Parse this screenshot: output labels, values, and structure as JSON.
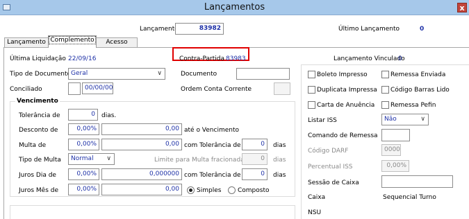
{
  "window": {
    "title": "Lançamentos",
    "close_glyph": "x"
  },
  "header": {
    "lancamento_label": "Lançamento",
    "lancamento_value": "83982",
    "ultimo_label": "Último Lançamento",
    "ultimo_value": "0"
  },
  "tabs": [
    {
      "label": "Lançamento",
      "active": false
    },
    {
      "label": "Complemento",
      "active": true
    },
    {
      "label": "Acesso",
      "active": false
    }
  ],
  "form": {
    "ultima_liquidacao_label": "Última Liquidação",
    "ultima_liquidacao_value": "22/09/16",
    "contra_partida_label": "Contra-Partida",
    "contra_partida_value": "83983",
    "lancamento_vinculado_label": "Lançamento Vinculado",
    "lancamento_vinculado_value": "0",
    "tipo_documento_label": "Tipo de Documento",
    "tipo_documento_value": "Geral",
    "documento_label": "Documento",
    "documento_value": "",
    "conciliado_label": "Conciliado",
    "conciliado_date": "00/00/00",
    "ordem_label": "Ordem Conta Corrente",
    "ordem_value": ""
  },
  "vencimento": {
    "title": "Vencimento",
    "tolerancia_label": "Tolerância de",
    "tolerancia_value": "0",
    "tolerancia_unit": "dias.",
    "desconto_label": "Desconto de",
    "desconto_pct": "0,00%",
    "desconto_value": "0,00",
    "desconto_suffix": "até o Vencimento",
    "multa_label": "Multa de",
    "multa_pct": "0,00%",
    "multa_value": "0,00",
    "multa_tol_label": "com Tolerância de",
    "multa_tol_value": "0",
    "multa_tol_unit": "dias",
    "tipo_multa_label": "Tipo de Multa",
    "tipo_multa_value": "Normal",
    "limite_label": "Limite para Multa fracionada",
    "limite_value": "0",
    "limite_unit": "dias",
    "juros_dia_label": "Juros Dia de",
    "juros_dia_pct": "0,00%",
    "juros_dia_value": "0,000000",
    "juros_dia_tol_label": "com Tolerância de",
    "juros_dia_tol_value": "0",
    "juros_dia_tol_unit": "dias",
    "juros_mes_label": "Juros Mês de",
    "juros_mes_pct": "0,00%",
    "juros_mes_value": "0,00",
    "simples_label": "Simples",
    "composto_label": "Composto",
    "selected": "Simples"
  },
  "right": {
    "boleto_impresso": "Boleto Impresso",
    "remessa_enviada": "Remessa Enviada",
    "duplicata_impressa": "Duplicata Impressa",
    "codigo_barras_lido": "Código Barras Lido",
    "carta_anuencia": "Carta de Anuência",
    "remessa_pefin": "Remessa Pefin",
    "listar_iss_label": "Listar ISS",
    "listar_iss_value": "Não",
    "comando_remessa_label": "Comando de Remessa",
    "comando_remessa_value": "",
    "codigo_darf_label": "Código DARF",
    "codigo_darf_value": "0000",
    "percentual_iss_label": "Percentual ISS",
    "percentual_iss_value": "0,00%",
    "sessao_caixa_label": "Sessão de Caixa",
    "sessao_caixa_value": "",
    "caixa_label": "Caixa",
    "sequencial_turno_label": "Sequencial Turno",
    "nsu_label": "NSU"
  },
  "colors": {
    "titlebar": "#a6c8ea",
    "highlight": "#e00000",
    "value_blue": "#1c2fa6",
    "close": "#c1443a"
  }
}
